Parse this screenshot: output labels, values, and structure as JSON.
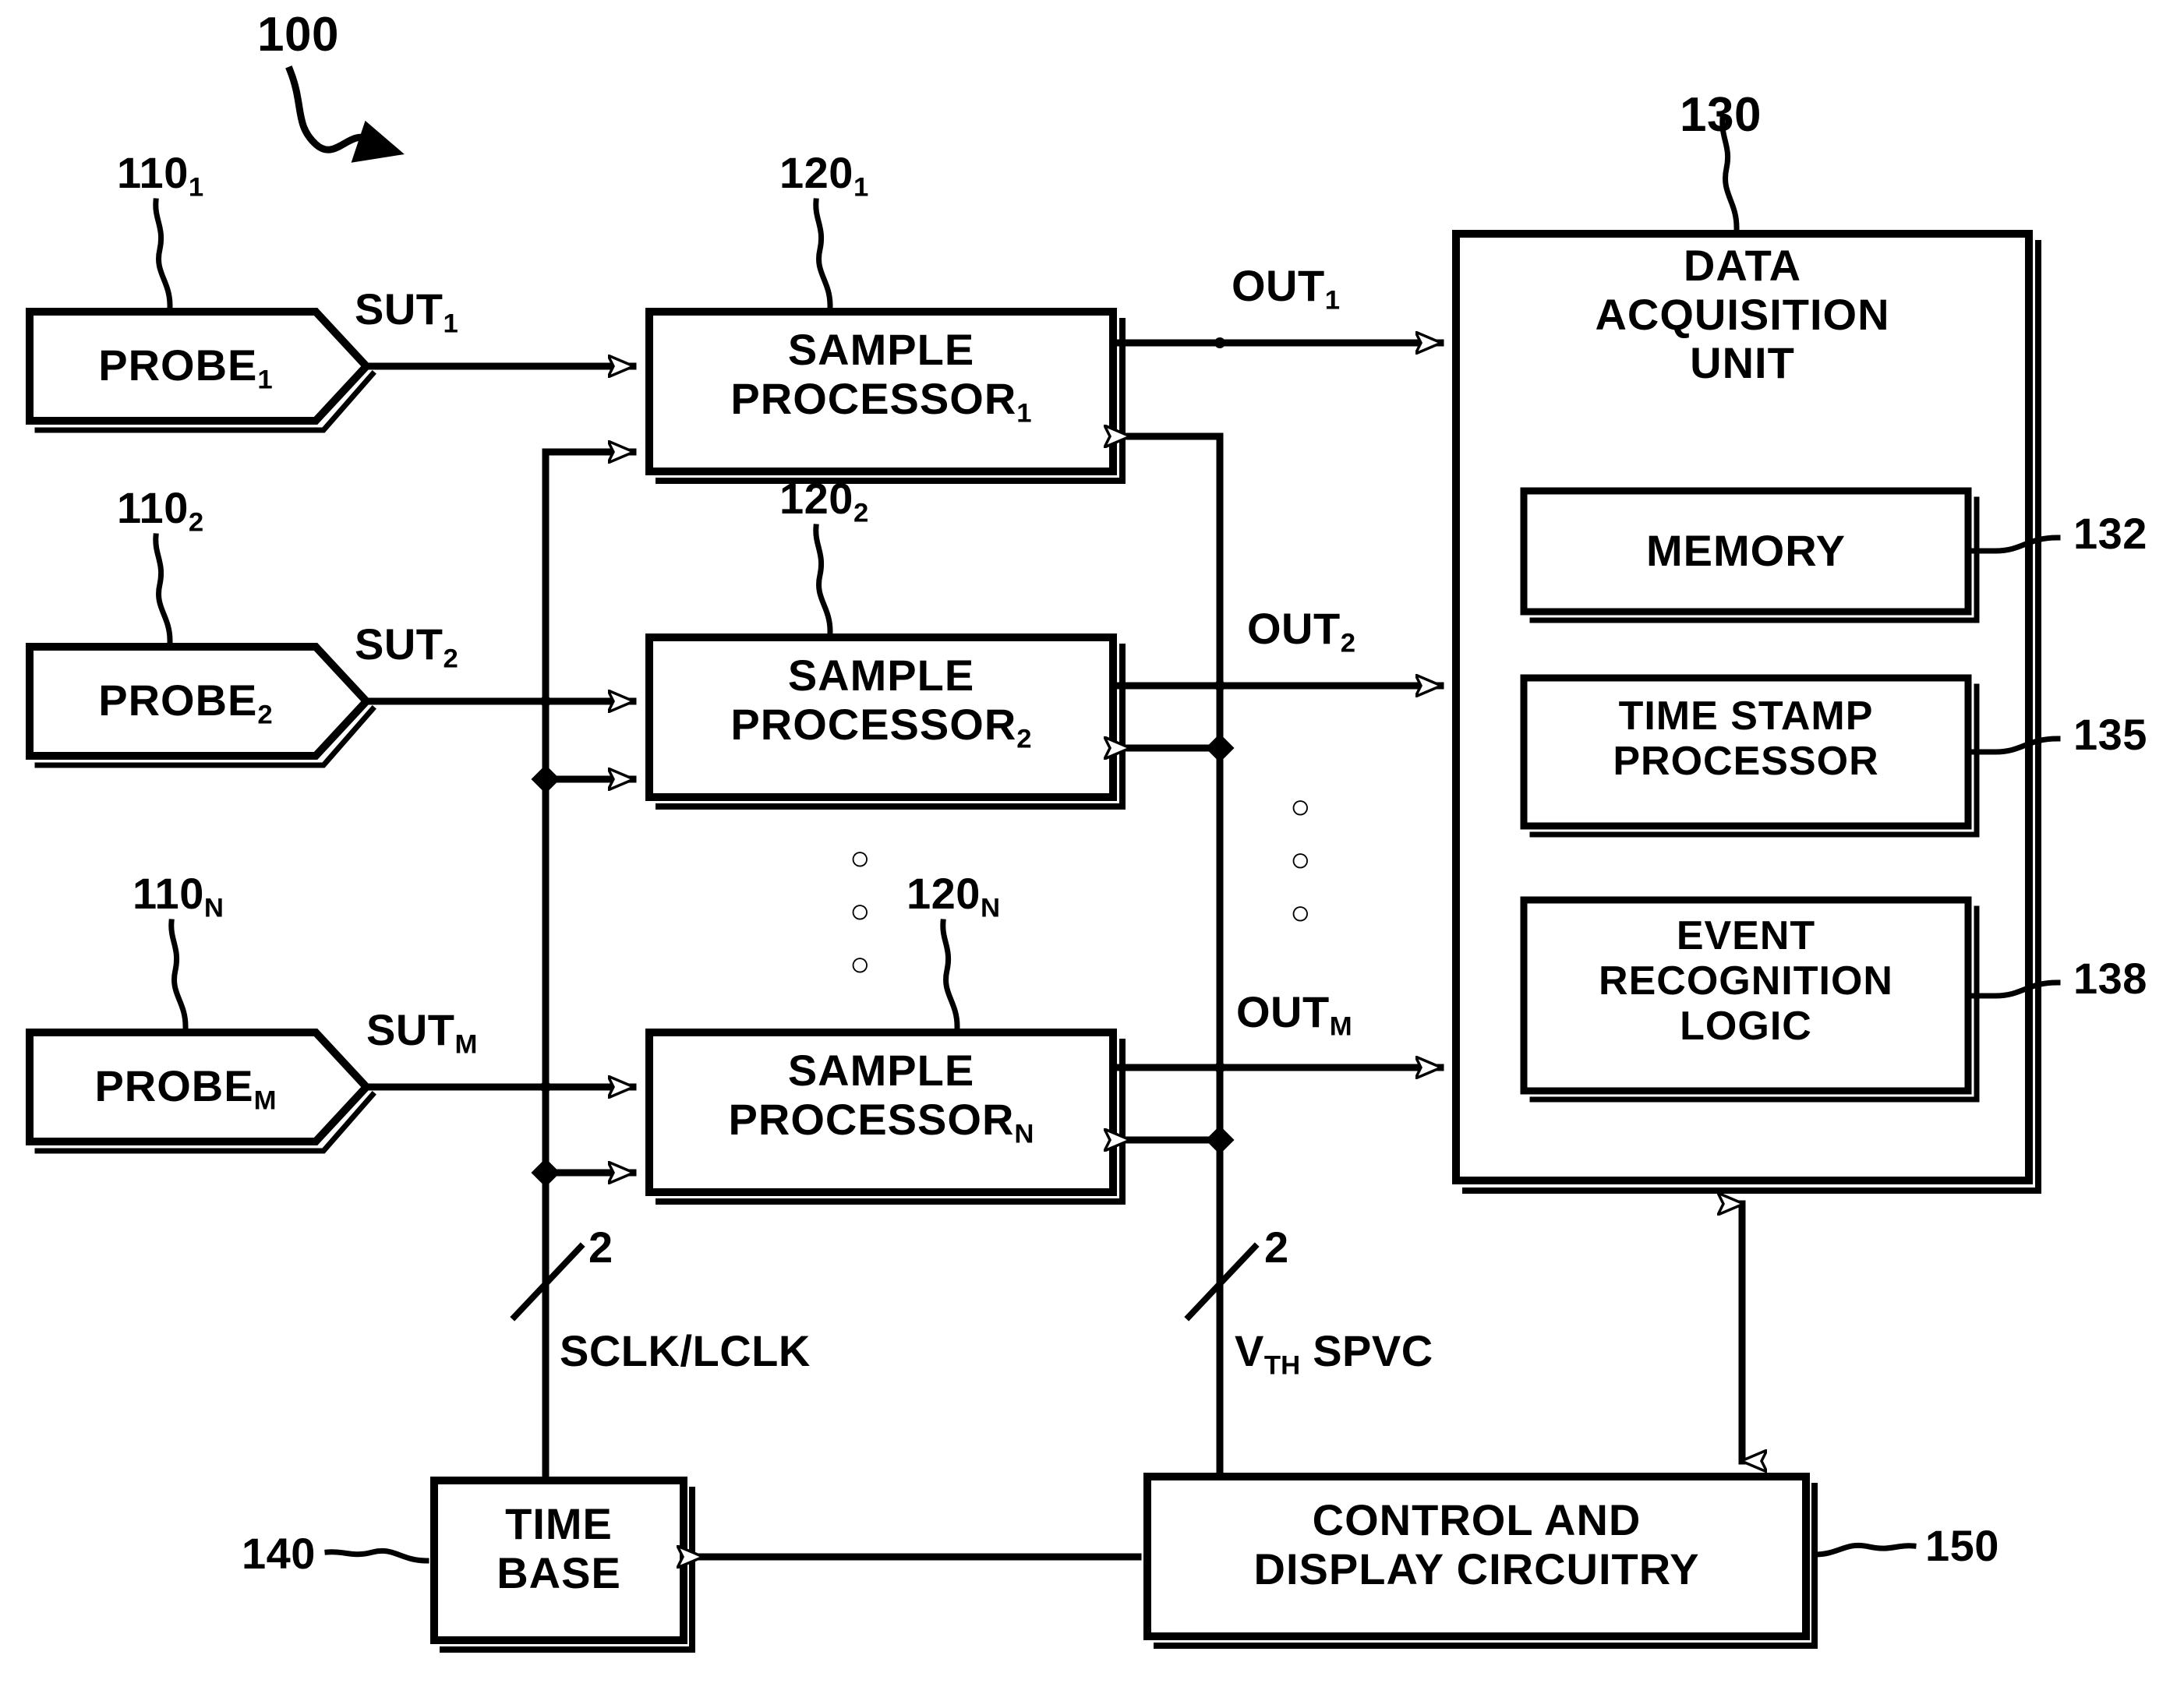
{
  "figure": {
    "type": "patent-block-diagram",
    "system_ref": "100"
  },
  "probes": [
    {
      "label": "PROBE",
      "sub": "1",
      "ref": "110",
      "ref_sub": "1",
      "signal": "SUT",
      "signal_sub": "1"
    },
    {
      "label": "PROBE",
      "sub": "2",
      "ref": "110",
      "ref_sub": "2",
      "signal": "SUT",
      "signal_sub": "2"
    },
    {
      "label": "PROBE",
      "sub": "M",
      "ref": "110",
      "ref_sub": "N",
      "signal": "SUT",
      "signal_sub": "M"
    }
  ],
  "sample_processors": [
    {
      "line1": "SAMPLE",
      "line2": "PROCESSOR",
      "sub": "1",
      "ref": "120",
      "ref_sub": "1",
      "out": "OUT",
      "out_sub": "1"
    },
    {
      "line1": "SAMPLE",
      "line2": "PROCESSOR",
      "sub": "2",
      "ref": "120",
      "ref_sub": "2",
      "out": "OUT",
      "out_sub": "2"
    },
    {
      "line1": "SAMPLE",
      "line2": "PROCESSOR",
      "sub": "N",
      "ref": "120",
      "ref_sub": "N",
      "out": "OUT",
      "out_sub": "M"
    }
  ],
  "data_acquisition_unit": {
    "ref": "130",
    "title_line1": "DATA",
    "title_line2": "ACQUISITION",
    "title_line3": "UNIT",
    "subblocks": [
      {
        "ref": "132",
        "line1": "MEMORY",
        "line2": "",
        "line3": ""
      },
      {
        "ref": "135",
        "line1": "TIME STAMP",
        "line2": "PROCESSOR",
        "line3": ""
      },
      {
        "ref": "138",
        "line1": "EVENT",
        "line2": "RECOGNITION",
        "line3": "LOGIC"
      }
    ]
  },
  "time_base": {
    "ref": "140",
    "line1": "TIME",
    "line2": "BASE"
  },
  "control_display": {
    "ref": "150",
    "line1": "CONTROL AND",
    "line2": "DISPLAY CIRCUITRY"
  },
  "bus_labels": {
    "clock_bus": "SCLK/LCLK",
    "clock_bus_width": "2",
    "threshold_bus_main": "V",
    "threshold_bus_sub": "TH",
    "threshold_bus_rest": "SPVC",
    "threshold_bus_width": "2"
  },
  "ellipsis": {
    "glyph": "o",
    "count": 3
  }
}
